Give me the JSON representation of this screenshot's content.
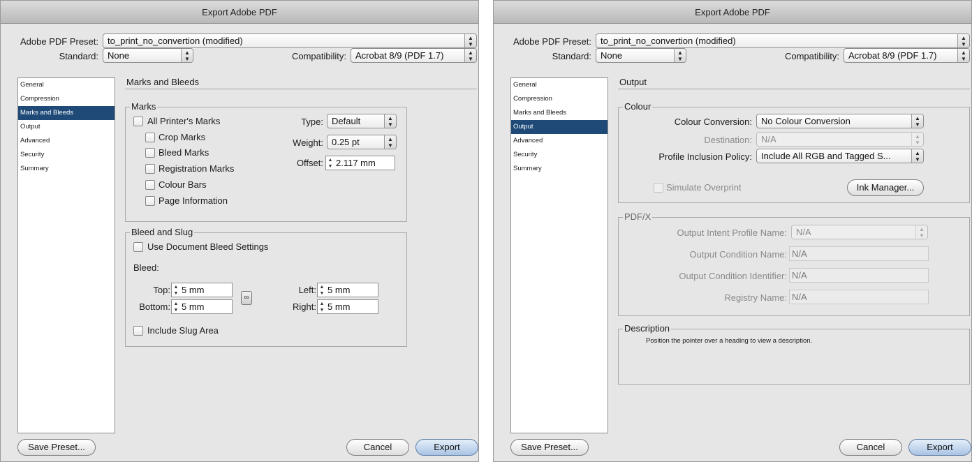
{
  "left": {
    "title": "Export Adobe PDF",
    "preset_label": "Adobe PDF Preset:",
    "preset_value": "to_print_no_convertion (modified)",
    "standard_label": "Standard:",
    "standard_value": "None",
    "compat_label": "Compatibility:",
    "compat_value": "Acrobat 8/9 (PDF 1.7)",
    "sidebar": [
      {
        "label": "General"
      },
      {
        "label": "Compression"
      },
      {
        "label": "Marks and Bleeds",
        "selected": true
      },
      {
        "label": "Output"
      },
      {
        "label": "Advanced"
      },
      {
        "label": "Security"
      },
      {
        "label": "Summary"
      }
    ],
    "section_title": "Marks and Bleeds",
    "marks": {
      "group_title": "Marks",
      "all_printers": "All Printer's Marks",
      "crop": "Crop Marks",
      "bleed": "Bleed Marks",
      "registration": "Registration Marks",
      "colour_bars": "Colour Bars",
      "page_info": "Page Information",
      "type_label": "Type:",
      "type_value": "Default",
      "weight_label": "Weight:",
      "weight_value": "0.25 pt",
      "offset_label": "Offset:",
      "offset_value": "2.117 mm"
    },
    "bleed": {
      "group_title": "Bleed and Slug",
      "use_doc": "Use Document Bleed Settings",
      "bleed_label": "Bleed:",
      "top_label": "Top:",
      "top_value": "5 mm",
      "bottom_label": "Bottom:",
      "bottom_value": "5 mm",
      "left_label": "Left:",
      "left_value": "5 mm",
      "right_label": "Right:",
      "right_value": "5 mm",
      "include_slug": "Include Slug Area"
    },
    "save_preset": "Save Preset...",
    "cancel": "Cancel",
    "export": "Export"
  },
  "right": {
    "title": "Export Adobe PDF",
    "preset_label": "Adobe PDF Preset:",
    "preset_value": "to_print_no_convertion (modified)",
    "standard_label": "Standard:",
    "standard_value": "None",
    "compat_label": "Compatibility:",
    "compat_value": "Acrobat 8/9 (PDF 1.7)",
    "sidebar": [
      {
        "label": "General"
      },
      {
        "label": "Compression"
      },
      {
        "label": "Marks and Bleeds"
      },
      {
        "label": "Output",
        "selected": true
      },
      {
        "label": "Advanced"
      },
      {
        "label": "Security"
      },
      {
        "label": "Summary"
      }
    ],
    "section_title": "Output",
    "colour": {
      "group_title": "Colour",
      "conversion_label": "Colour Conversion:",
      "conversion_value": "No Colour Conversion",
      "destination_label": "Destination:",
      "destination_value": "N/A",
      "profile_label": "Profile Inclusion Policy:",
      "profile_value": "Include All RGB and Tagged S...",
      "simulate": "Simulate Overprint",
      "ink_manager": "Ink Manager..."
    },
    "pdfx": {
      "group_title": "PDF/X",
      "intent_label": "Output Intent Profile Name:",
      "intent_value": "N/A",
      "condition_label": "Output Condition Name:",
      "condition_value": "N/A",
      "identifier_label": "Output Condition Identifier:",
      "identifier_value": "N/A",
      "registry_label": "Registry Name:",
      "registry_value": "N/A"
    },
    "description": {
      "group_title": "Description",
      "text": "Position the pointer over a heading to view a description."
    },
    "save_preset": "Save Preset...",
    "cancel": "Cancel",
    "export": "Export"
  },
  "icons": {
    "popup_arrows": "up-down-arrows-icon",
    "spinner": "stepper-icon",
    "chain": "chain-link-icon"
  }
}
